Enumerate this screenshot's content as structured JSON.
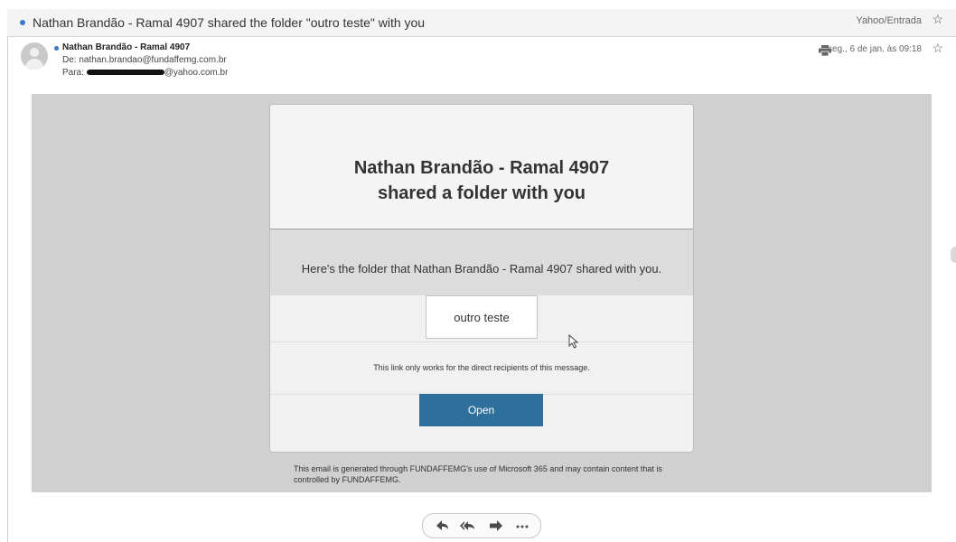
{
  "subject": "Nathan Brandão - Ramal 4907 shared the folder \"outro teste\" with you",
  "folder_label": "Yahoo/Entrada",
  "sender": {
    "name": "Nathan Brandão - Ramal 4907",
    "from": "De: nathan.brandao@fundaffemg.com.br",
    "to_prefix": "Para:",
    "to_suffix": "@yahoo.com.br"
  },
  "date": "seg., 6 de jan. às 09:18",
  "card": {
    "title_line1": "Nathan Brandão - Ramal 4907",
    "title_line2": "shared a folder with you",
    "intro": "Here's the folder that Nathan Brandão - Ramal 4907 shared with you.",
    "folder_name": "outro teste",
    "notice": "This link only works for the direct recipients of this message.",
    "open_label": "Open"
  },
  "footer": "This email is generated through FUNDAFFEMG's use of Microsoft 365 and may contain content that is controlled by FUNDAFFEMG.",
  "actions": [
    "reply-icon",
    "reply-all-icon",
    "forward-icon",
    "more-icon"
  ],
  "colors": {
    "accent_dot": "#3a78c9",
    "open_button": "#2e6f9b",
    "body_bg": "#d0d0d0"
  }
}
